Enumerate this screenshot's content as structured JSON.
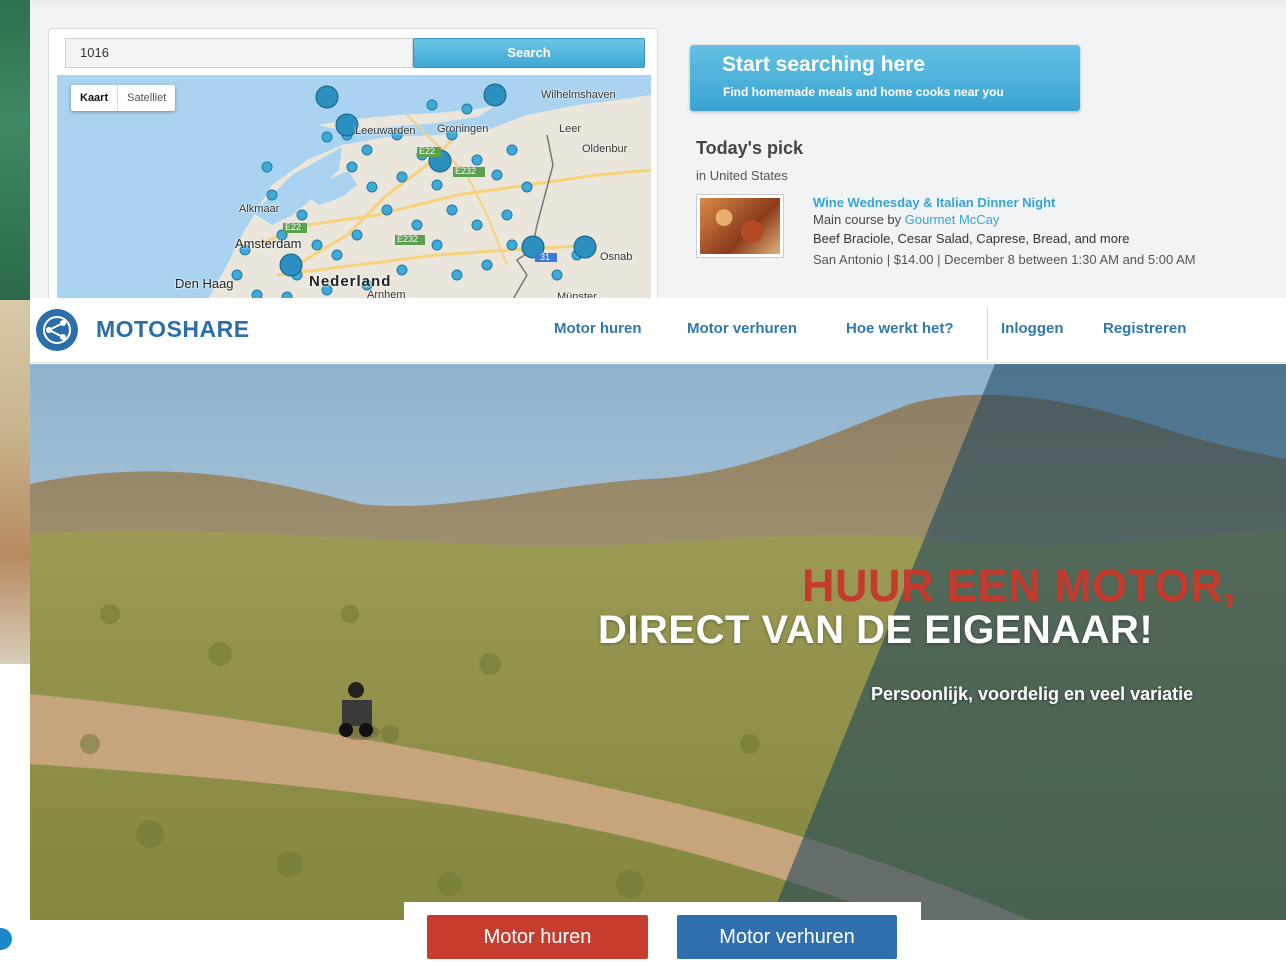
{
  "food_site": {
    "search": {
      "value": "1016",
      "button_label": "Search"
    },
    "map": {
      "toggle_map": "Kaart",
      "toggle_satellite": "Satelliet",
      "labels": {
        "wilhelmshaven": "Wilhelmshaven",
        "leeuwarden": "Leeuwarden",
        "groningen": "Groningen",
        "leer": "Leer",
        "oldenburg": "Oldenbur",
        "alkmaar": "Alkmaar",
        "amsterdam": "Amsterdam",
        "den_haag": "Den Haag",
        "nederland": "Nederland",
        "osnabruck": "Osnab",
        "arnhem": "Arnhem",
        "munster": "Münster",
        "e22_a": "E22",
        "e22_b": "E22",
        "e232_a": "E232",
        "e232_b": "E232",
        "road_31": "31"
      }
    },
    "callout": {
      "title": "Start searching here",
      "subtitle": "Find homemade meals and home cooks near you"
    },
    "todays_pick": {
      "heading": "Today's pick",
      "location": "in United States",
      "title": "Wine Wednesday & Italian Dinner Night",
      "course_prefix": "Main course by",
      "cook": "Gourmet McCay",
      "menu": "Beef Braciole, Cesar Salad, Caprese, Bread, and more",
      "meta": "San Antonio | $14.00 | December 8 between 1:30 AM and 5:00 AM"
    }
  },
  "motoshare": {
    "brand": "MOTOSHARE",
    "nav": {
      "rent": "Motor huren",
      "let": "Motor verhuren",
      "how": "Hoe werkt het?",
      "login": "Inloggen",
      "register": "Registreren"
    },
    "hero": {
      "title_red": "HUUR EEN MOTOR,",
      "title_white": "DIRECT VAN DE EIGENAAR!",
      "subtitle": "Persoonlijk, voordelig en veel variatie"
    },
    "cta": {
      "rent": "Motor huren",
      "let": "Motor verhuren"
    }
  },
  "colors": {
    "accent_blue": "#3ea8d6",
    "brand_blue": "#2b6ea8",
    "brand_red": "#c63d2f",
    "cta_blue": "#2f6fad"
  }
}
